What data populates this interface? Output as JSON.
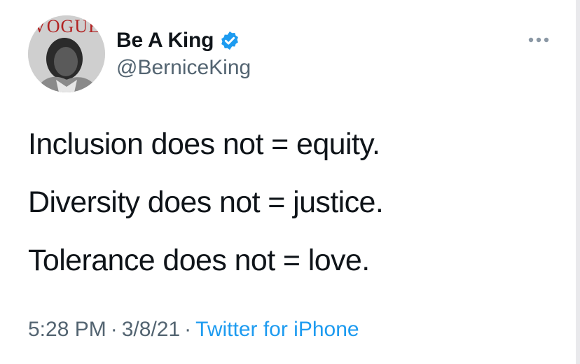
{
  "tweet": {
    "display_name": "Be A King",
    "handle": "@BerniceKing",
    "avatar_magazine_text": "VOGUE",
    "lines": [
      "Inclusion does not = equity.",
      "Diversity does not = justice.",
      "Tolerance does not = love."
    ],
    "time": "5:28 PM",
    "separator": "·",
    "date": "3/8/21",
    "source": "Twitter for iPhone"
  },
  "icons": {
    "verified": "verified-badge-icon",
    "more": "more-options-icon"
  },
  "colors": {
    "text_primary": "#0f1419",
    "text_secondary": "#536471",
    "accent": "#1d9bf0",
    "verified": "#1d9bf0"
  }
}
